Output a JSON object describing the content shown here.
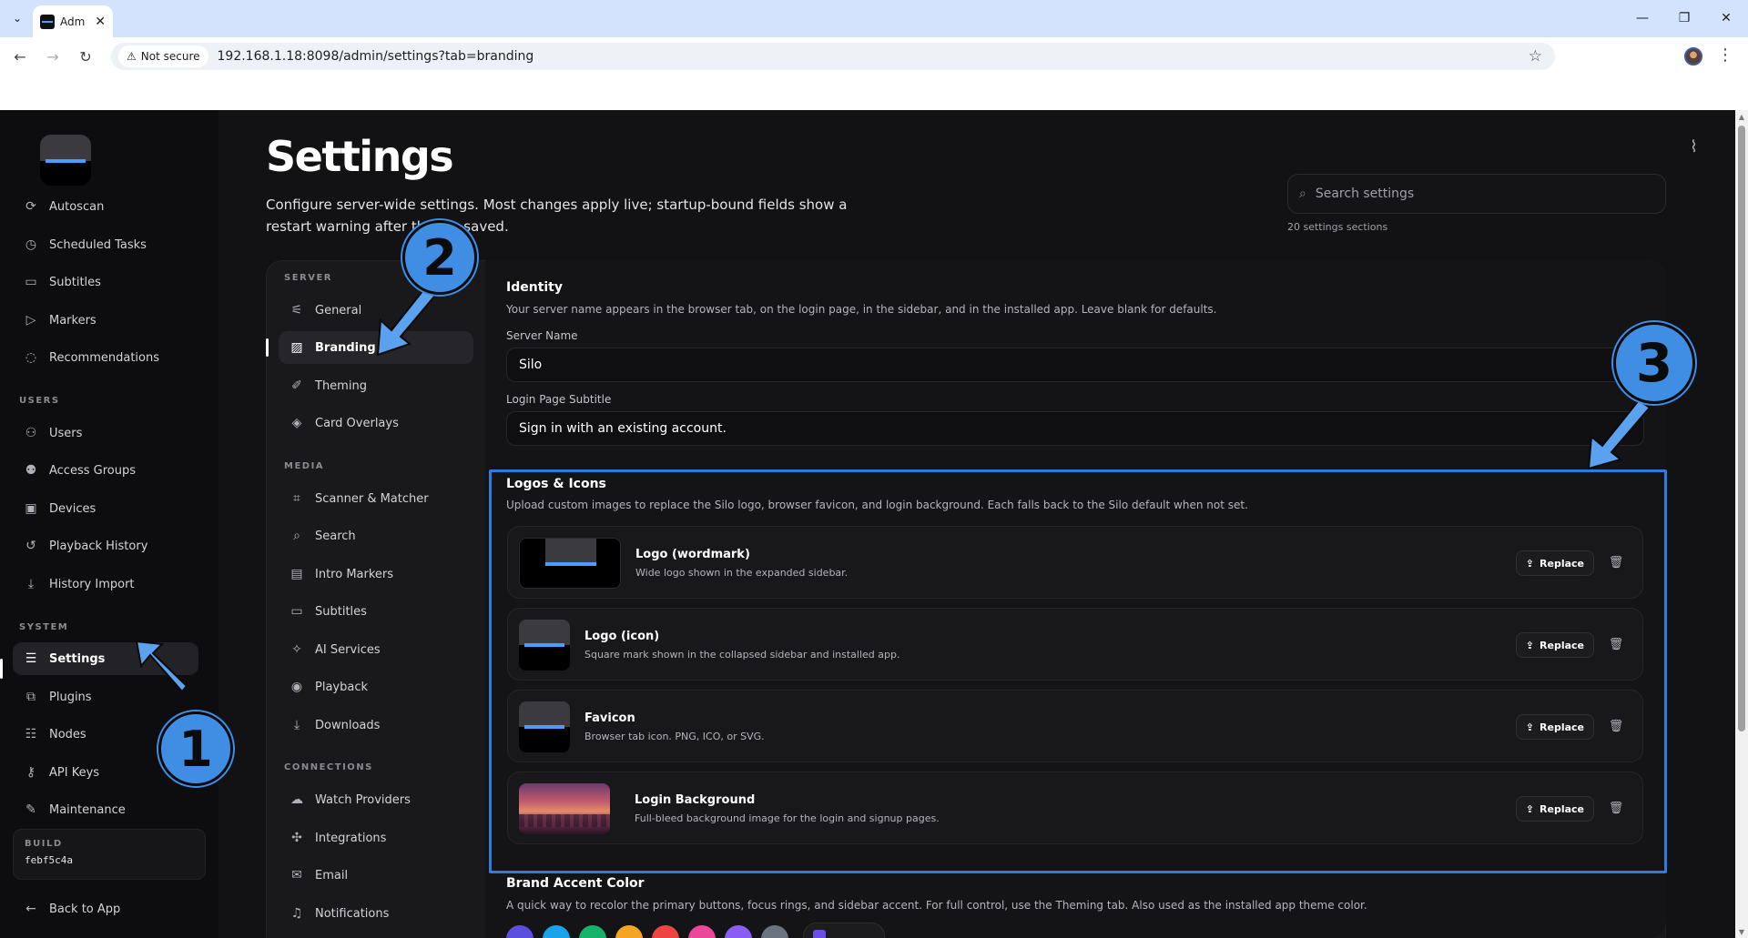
{
  "browser": {
    "tab_title": "Adm",
    "security_label": "Not secure",
    "url": "192.168.1.18:8098/admin/settings?tab=branding"
  },
  "sidebar": {
    "sections": [
      "USERS",
      "SYSTEM"
    ],
    "items": [
      {
        "label": "Autoscan",
        "icon": "autoscan-icon"
      },
      {
        "label": "Scheduled Tasks",
        "icon": "calendar-icon"
      },
      {
        "label": "Subtitles",
        "icon": "subtitles-icon"
      },
      {
        "label": "Markers",
        "icon": "marker-icon"
      },
      {
        "label": "Recommendations",
        "icon": "recommendations-icon"
      },
      {
        "label": "Users",
        "icon": "users-icon"
      },
      {
        "label": "Access Groups",
        "icon": "user-group-icon"
      },
      {
        "label": "Devices",
        "icon": "devices-icon"
      },
      {
        "label": "Playback History",
        "icon": "history-icon"
      },
      {
        "label": "History Import",
        "icon": "import-icon"
      },
      {
        "label": "Settings",
        "icon": "sliders-icon"
      },
      {
        "label": "Plugins",
        "icon": "plugin-icon"
      },
      {
        "label": "Nodes",
        "icon": "server-icon"
      },
      {
        "label": "API Keys",
        "icon": "key-icon"
      },
      {
        "label": "Maintenance",
        "icon": "wrench-icon"
      }
    ],
    "build_label": "BUILD",
    "build_hash": "febf5c4a",
    "back_label": "Back to App"
  },
  "header": {
    "title": "Settings",
    "description": "Configure server-wide settings. Most changes apply live; startup-bound fields show a restart warning after they're saved.",
    "search_placeholder": "Search settings",
    "sections_count": "20 settings sections"
  },
  "subnav": {
    "sections": [
      "SERVER",
      "MEDIA",
      "CONNECTIONS"
    ],
    "items": [
      {
        "label": "General"
      },
      {
        "label": "Branding"
      },
      {
        "label": "Theming"
      },
      {
        "label": "Card Overlays"
      },
      {
        "label": "Scanner & Matcher"
      },
      {
        "label": "Search"
      },
      {
        "label": "Intro Markers"
      },
      {
        "label": "Subtitles"
      },
      {
        "label": "AI Services"
      },
      {
        "label": "Playback"
      },
      {
        "label": "Downloads"
      },
      {
        "label": "Watch Providers"
      },
      {
        "label": "Integrations"
      },
      {
        "label": "Email"
      },
      {
        "label": "Notifications"
      }
    ]
  },
  "identity": {
    "title": "Identity",
    "description": "Your server name appears in the browser tab, on the login page, in the sidebar, and in the installed app. Leave blank for defaults.",
    "server_name_label": "Server Name",
    "server_name_value": "Silo",
    "subtitle_label": "Login Page Subtitle",
    "subtitle_value": "Sign in with an existing account."
  },
  "logos": {
    "title": "Logos & Icons",
    "description": "Upload custom images to replace the Silo logo, browser favicon, and login background. Each falls back to the Silo default when not set.",
    "replace_label": "Replace",
    "assets": [
      {
        "name": "Logo (wordmark)",
        "desc": "Wide logo shown in the expanded sidebar."
      },
      {
        "name": "Logo (icon)",
        "desc": "Square mark shown in the collapsed sidebar and installed app."
      },
      {
        "name": "Favicon",
        "desc": "Browser tab icon. PNG, ICO, or SVG."
      },
      {
        "name": "Login Background",
        "desc": "Full-bleed background image for the login and signup pages."
      }
    ]
  },
  "accent": {
    "title": "Brand Accent Color",
    "description": "A quick way to recolor the primary buttons, focus rings, and sidebar accent. For full control, use the Theming tab. Also used as the installed app theme color.",
    "swatches": [
      "#5b4fe0",
      "#1aa3e8",
      "#17b26a",
      "#f5a524",
      "#ef4444",
      "#ec4899",
      "#8b5cf6",
      "#6b7280"
    ]
  },
  "annotations": [
    "1",
    "2",
    "3"
  ]
}
